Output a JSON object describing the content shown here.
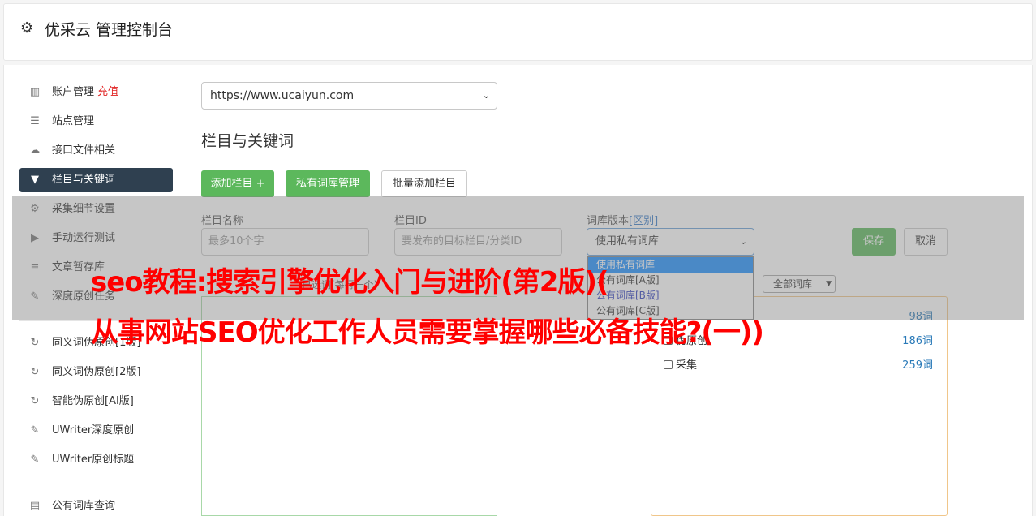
{
  "header": {
    "title": "优采云 管理控制台",
    "icon": "gear-icon"
  },
  "sidebar": {
    "items": [
      {
        "label": "账户管理",
        "extra": "充值",
        "icon": "bar-chart-icon"
      },
      {
        "label": "站点管理",
        "icon": "server-icon"
      },
      {
        "label": "接口文件相关",
        "icon": "cloud-upload-icon"
      },
      {
        "label": "栏目与关键词",
        "icon": "filter-icon",
        "active": true
      },
      {
        "label": "采集细节设置",
        "icon": "cogs-icon"
      },
      {
        "label": "手动运行测试",
        "icon": "play-icon"
      },
      {
        "label": "文章暂存库",
        "icon": "database-icon"
      },
      {
        "label": "深度原创任务",
        "icon": "edit-icon"
      },
      {
        "label": "同义词伪原创[1版]",
        "icon": "refresh-icon"
      },
      {
        "label": "同义词伪原创[2版]",
        "icon": "refresh-icon"
      },
      {
        "label": "智能伪原创[AI版]",
        "icon": "refresh-icon"
      },
      {
        "label": "UWriter深度原创",
        "icon": "edit-icon"
      },
      {
        "label": "UWriter原创标题",
        "icon": "edit-icon"
      },
      {
        "label": "公有词库查询",
        "icon": "book-icon"
      }
    ]
  },
  "main": {
    "site_select": "https://www.ucaiyun.com",
    "section_title": "栏目与关键词",
    "buttons": {
      "add_column": "添加栏目 +",
      "private_lib": "私有词库管理",
      "batch_add": "批量添加栏目"
    },
    "form": {
      "name_label": "栏目名称",
      "name_placeholder": "最多10个字",
      "id_label": "栏目ID",
      "id_placeholder": "要发布的目标栏目/分类ID",
      "lib_label": "词库版本",
      "lib_label_link": "[区别]",
      "lib_value": "使用私有词库",
      "save": "保存",
      "cancel": "取消"
    },
    "dropdown_options": [
      "使用私有词库",
      "公有词库[A版]",
      "公有词库[B版]",
      "公有词库[C版]"
    ],
    "filter_select": "全部词库",
    "ghost_hint": "已选词(每行一个)",
    "lib_list": [
      {
        "name": "原创",
        "count": "98词"
      },
      {
        "name": "伪原创",
        "count": "186词"
      },
      {
        "name": "采集",
        "count": "259词"
      }
    ]
  },
  "banner": {
    "line1": "seo教程:搜索引擎优化入门与进阶(第2版)(",
    "line2": "从事网站SEO优化工作人员需要掌握哪些必备技能?(一))"
  }
}
